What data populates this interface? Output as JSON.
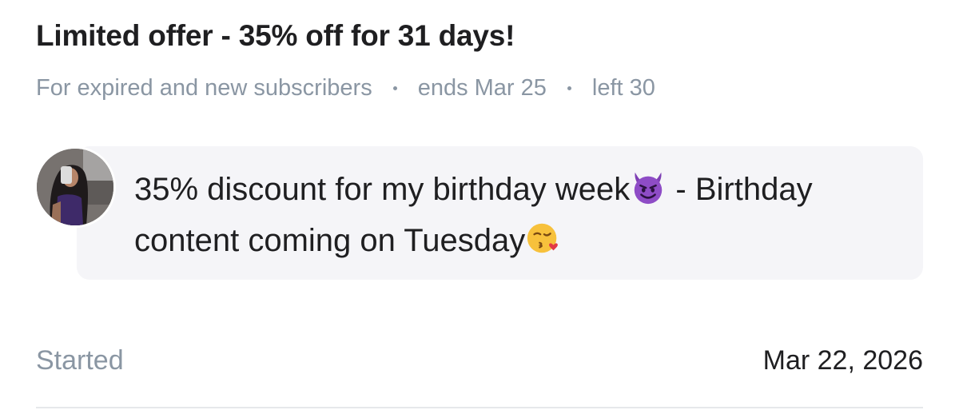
{
  "offer": {
    "title": "Limited offer - 35% off for 31 days!",
    "audience": "For expired and new subscribers",
    "ends": "ends Mar 25",
    "left": "left 30"
  },
  "message": {
    "part1": "35% discount for my birthday week",
    "emoji1": "smiling-devil-icon",
    "part2": " - Birthday content coming on Tuesday",
    "emoji2": "face-blowing-kiss-icon"
  },
  "details": {
    "started_label": "Started",
    "started_value": "Mar 22, 2026"
  },
  "colors": {
    "title": "#1f1f21",
    "muted": "#8a96a3",
    "bubble": "#f5f5f8",
    "devil": "#7e3fb4",
    "kiss": "#f7c13c"
  }
}
